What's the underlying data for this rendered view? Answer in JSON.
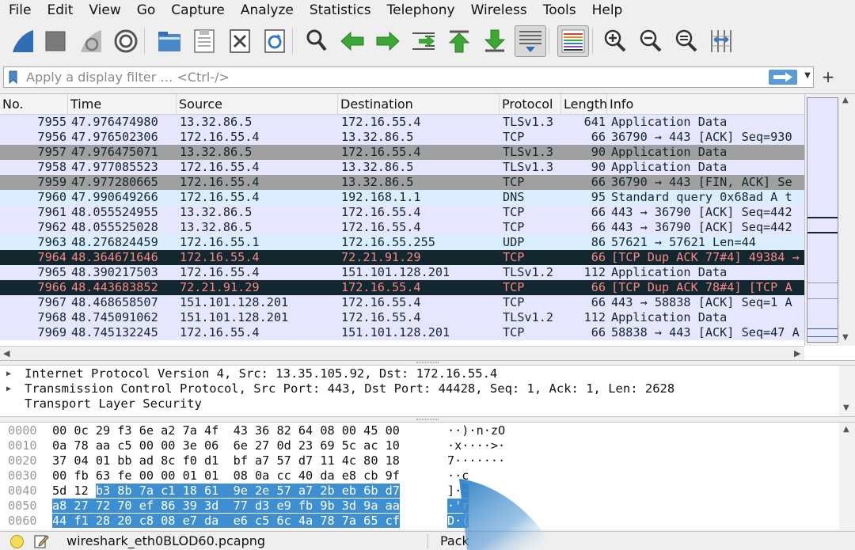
{
  "menu": [
    "File",
    "Edit",
    "View",
    "Go",
    "Capture",
    "Analyze",
    "Statistics",
    "Telephony",
    "Wireless",
    "Tools",
    "Help"
  ],
  "toolbar": {
    "buttons": [
      {
        "name": "start-capture-icon",
        "color": "#2f6db5"
      },
      {
        "name": "stop-capture-icon",
        "color": "#7a7a7a"
      },
      {
        "name": "restart-capture-icon",
        "color": "#9a9a9a"
      },
      {
        "name": "capture-options-icon",
        "color": "#555555"
      },
      {
        "name": "open-file-icon",
        "color": "#4a88c8"
      },
      {
        "name": "save-file-icon",
        "color": "#777777"
      },
      {
        "name": "close-file-icon",
        "color": "#444444"
      },
      {
        "name": "reload-file-icon",
        "color": "#3a78c0"
      },
      {
        "name": "find-packet-icon",
        "color": "#333333"
      },
      {
        "name": "go-back-icon",
        "color": "#3aa832"
      },
      {
        "name": "go-forward-icon",
        "color": "#3aa832"
      },
      {
        "name": "go-to-packet-icon",
        "color": "#3aa832"
      },
      {
        "name": "go-first-packet-icon",
        "color": "#3aa832"
      },
      {
        "name": "go-last-packet-icon",
        "color": "#3aa832"
      },
      {
        "name": "autoscroll-icon",
        "color": "#555555"
      },
      {
        "name": "colorize-icon",
        "color": "#d24040"
      },
      {
        "name": "zoom-in-icon",
        "color": "#333333"
      },
      {
        "name": "zoom-out-icon",
        "color": "#333333"
      },
      {
        "name": "zoom-normal-icon",
        "color": "#333333"
      },
      {
        "name": "resize-columns-icon",
        "color": "#3a78c0"
      }
    ]
  },
  "filter": {
    "placeholder": "Apply a display filter … <Ctrl-/>",
    "plus": "+"
  },
  "packet_list": {
    "columns": [
      "No.",
      "Time",
      "Source",
      "Destination",
      "Protocol",
      "Length",
      "Info"
    ],
    "rows": [
      {
        "no": "7955",
        "time": "47.976474980",
        "src": "13.32.86.5",
        "dst": "172.16.55.4",
        "proto": "TLSv1.3",
        "len": "641",
        "info": "Application Data",
        "style": "lav"
      },
      {
        "no": "7956",
        "time": "47.976502306",
        "src": "172.16.55.4",
        "dst": "13.32.86.5",
        "proto": "TCP",
        "len": "66",
        "info": "36790 → 443 [ACK] Seq=930",
        "style": "lav"
      },
      {
        "no": "7957",
        "time": "47.976475071",
        "src": "13.32.86.5",
        "dst": "172.16.55.4",
        "proto": "TLSv1.3",
        "len": "90",
        "info": "Application Data",
        "style": "gray"
      },
      {
        "no": "7958",
        "time": "47.977085523",
        "src": "172.16.55.4",
        "dst": "13.32.86.5",
        "proto": "TLSv1.3",
        "len": "90",
        "info": "Application Data",
        "style": "lav"
      },
      {
        "no": "7959",
        "time": "47.977280665",
        "src": "172.16.55.4",
        "dst": "13.32.86.5",
        "proto": "TCP",
        "len": "66",
        "info": "36790 → 443 [FIN, ACK] Se",
        "style": "gray"
      },
      {
        "no": "7960",
        "time": "47.990649266",
        "src": "172.16.55.4",
        "dst": "192.168.1.1",
        "proto": "DNS",
        "len": "95",
        "info": "Standard query 0x68ad A t",
        "style": "lblue"
      },
      {
        "no": "7961",
        "time": "48.055524955",
        "src": "13.32.86.5",
        "dst": "172.16.55.4",
        "proto": "TCP",
        "len": "66",
        "info": "443 → 36790 [ACK] Seq=442",
        "style": "lav"
      },
      {
        "no": "7962",
        "time": "48.055525028",
        "src": "13.32.86.5",
        "dst": "172.16.55.4",
        "proto": "TCP",
        "len": "66",
        "info": "443 → 36790 [ACK] Seq=442",
        "style": "lav"
      },
      {
        "no": "7963",
        "time": "48.276824459",
        "src": "172.16.55.1",
        "dst": "172.16.55.255",
        "proto": "UDP",
        "len": "86",
        "info": "57621 → 57621 Len=44",
        "style": "lblue"
      },
      {
        "no": "7964",
        "time": "48.364671646",
        "src": "172.16.55.4",
        "dst": "72.21.91.29",
        "proto": "TCP",
        "len": "66",
        "info": "[TCP Dup ACK 77#4] 49384 →",
        "style": "dark"
      },
      {
        "no": "7965",
        "time": "48.390217503",
        "src": "172.16.55.4",
        "dst": "151.101.128.201",
        "proto": "TLSv1.2",
        "len": "112",
        "info": "Application Data",
        "style": "lav"
      },
      {
        "no": "7966",
        "time": "48.443683852",
        "src": "72.21.91.29",
        "dst": "172.16.55.4",
        "proto": "TCP",
        "len": "66",
        "info": "[TCP Dup ACK 78#4] [TCP A",
        "style": "dark"
      },
      {
        "no": "7967",
        "time": "48.468658507",
        "src": "151.101.128.201",
        "dst": "172.16.55.4",
        "proto": "TCP",
        "len": "66",
        "info": "443 → 58838 [ACK] Seq=1 A",
        "style": "lav"
      },
      {
        "no": "7968",
        "time": "48.745091062",
        "src": "151.101.128.201",
        "dst": "172.16.55.4",
        "proto": "TLSv1.2",
        "len": "112",
        "info": "Application Data",
        "style": "lav"
      },
      {
        "no": "7969",
        "time": "48.745132245",
        "src": "172.16.55.4",
        "dst": "151.101.128.201",
        "proto": "TCP",
        "len": "66",
        "info": "58838 → 443 [ACK] Seq=47 A",
        "style": "lav"
      }
    ]
  },
  "details": {
    "lines": [
      {
        "text": "Internet Protocol Version 4, Src: 13.35.105.92, Dst: 172.16.55.4",
        "expandable": true
      },
      {
        "text": "Transmission Control Protocol, Src Port: 443, Dst Port: 44428, Seq: 1, Ack: 1, Len: 2628",
        "expandable": true
      },
      {
        "text": "Transport Layer Security",
        "expandable": false
      }
    ]
  },
  "bytes": {
    "rows": [
      {
        "offset": "0000",
        "hex_plain": "00 0c 29 f3 6e a2 7a 4f  43 36 82 64 08 00 45 00",
        "hex_sel": "",
        "ascii_plain": "··)·n·zO",
        "ascii_sel": ""
      },
      {
        "offset": "0010",
        "hex_plain": "0a 78 aa c5 00 00 3e 06  6e 27 0d 23 69 5c ac 10",
        "hex_sel": "",
        "ascii_plain": "·x····>·",
        "ascii_sel": ""
      },
      {
        "offset": "0020",
        "hex_plain": "37 04 01 bb ad 8c f0 d1  bf a7 57 d7 11 4c 80 18",
        "hex_sel": "",
        "ascii_plain": "7·······",
        "ascii_sel": ""
      },
      {
        "offset": "0030",
        "hex_plain": "00 fb 63 fe 00 00 01 01  08 0a cc 40 da e8 cb 9f",
        "hex_sel": "",
        "ascii_plain": "··c",
        "ascii_sel": ""
      },
      {
        "offset": "0040",
        "hex_plain": "5d 12 ",
        "hex_sel": "b3 8b 7a c1 18 61  9e 2e 57 a7 2b eb 6b d7",
        "ascii_plain": "]·",
        "ascii_sel": "·"
      },
      {
        "offset": "0050",
        "hex_plain": "",
        "hex_sel": "a8 27 72 70 ef 86 39 3d  77 d3 e9 fb 9b 3d 9a aa",
        "ascii_plain": "",
        "ascii_sel": "·'r"
      },
      {
        "offset": "0060",
        "hex_plain": "",
        "hex_sel": "44 f1 28 20 c8 08 e7 da  e6 c5 6c 4a 78 7a 65 cf",
        "ascii_plain": "",
        "ascii_sel": "D·("
      }
    ]
  },
  "status": {
    "file": "wireshark_eth0BLOD60.pcapng",
    "packets": "Pack"
  },
  "colors": {
    "row_lavender": "#e7e6ff",
    "row_gray": "#a0a0a0",
    "row_lightblue": "#daeeff",
    "row_dark": "#12272e",
    "row_dark_text": "#f78787",
    "selection": "#3d8fd1"
  }
}
